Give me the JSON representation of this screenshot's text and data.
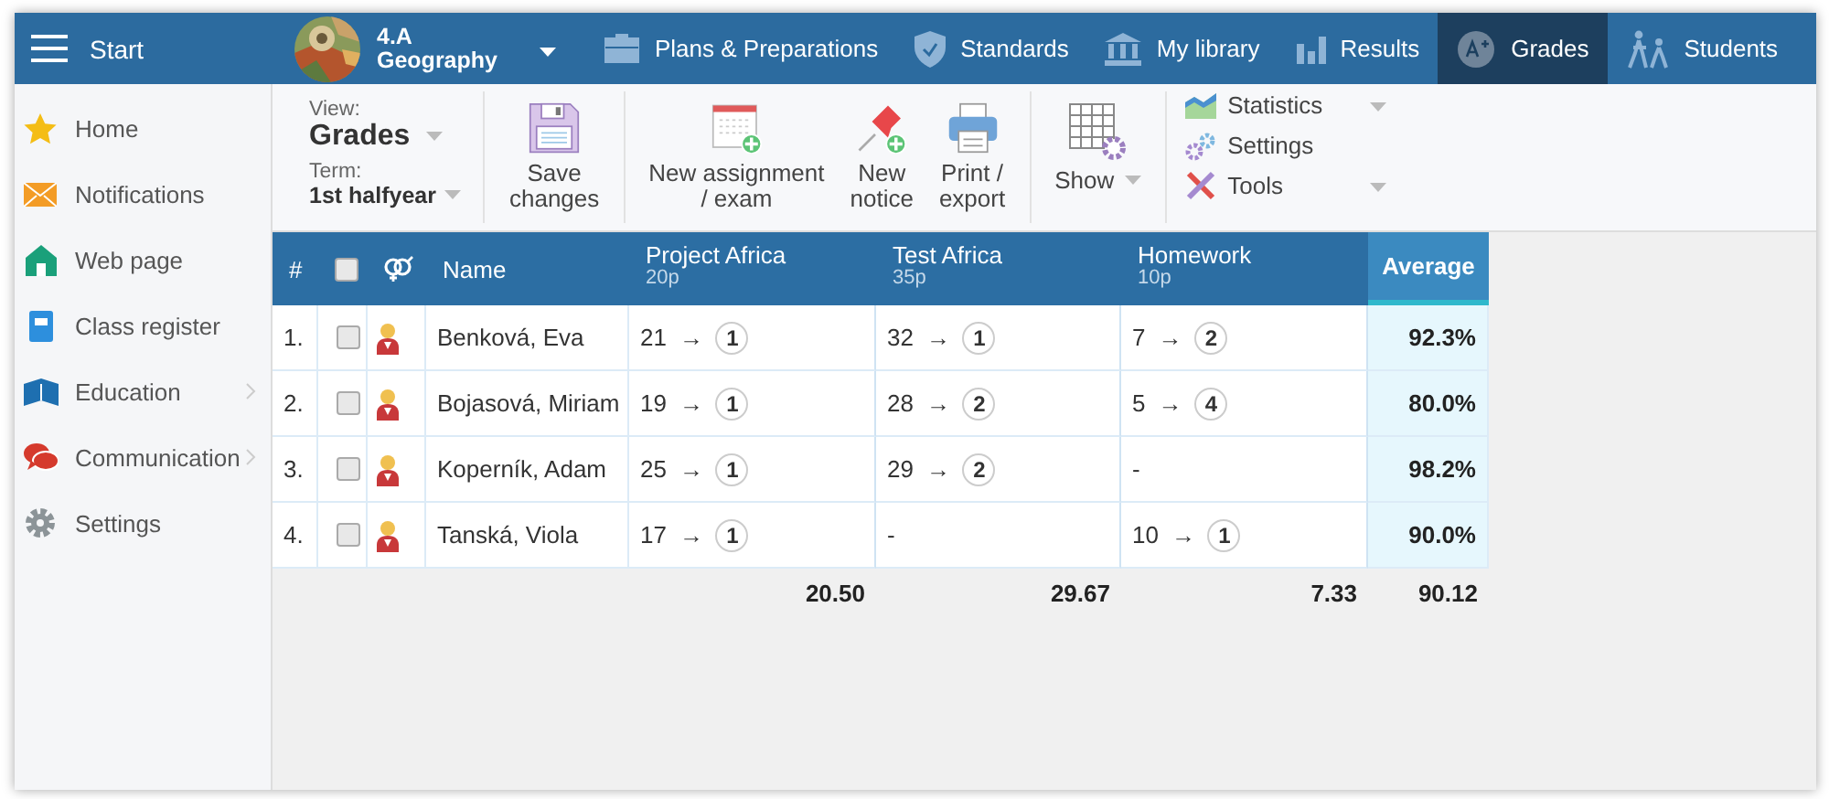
{
  "topbar": {
    "menu_label": "Start",
    "class_name": "4.A",
    "subject": "Geography",
    "nav": [
      {
        "label": "Plans & Preparations",
        "selected": false
      },
      {
        "label": "Standards",
        "selected": false
      },
      {
        "label": "My library",
        "selected": false
      },
      {
        "label": "Results",
        "selected": false
      },
      {
        "label": "Grades",
        "selected": true
      },
      {
        "label": "Students",
        "selected": false
      }
    ]
  },
  "sidebar": {
    "items": [
      {
        "label": "Home",
        "expandable": false
      },
      {
        "label": "Notifications",
        "expandable": false
      },
      {
        "label": "Web page",
        "expandable": false
      },
      {
        "label": "Class register",
        "expandable": false
      },
      {
        "label": "Education",
        "expandable": true
      },
      {
        "label": "Communication",
        "expandable": true
      },
      {
        "label": "Settings",
        "expandable": false
      }
    ]
  },
  "toolbar": {
    "view": {
      "label": "View:",
      "value": "Grades"
    },
    "term": {
      "label": "Term:",
      "value": "1st halfyear"
    },
    "groups": [
      [
        {
          "label": "Save\nchanges",
          "dropdown": false
        }
      ],
      [
        {
          "label": "New assignment\n/ exam",
          "dropdown": false
        },
        {
          "label": "New\nnotice",
          "dropdown": false
        },
        {
          "label": "Print /\nexport",
          "dropdown": false
        }
      ],
      [
        {
          "label": "Show",
          "dropdown": true
        }
      ]
    ],
    "menu": [
      {
        "label": "Statistics",
        "dropdown": true
      },
      {
        "label": "Settings",
        "dropdown": false
      },
      {
        "label": "Tools",
        "dropdown": true
      }
    ]
  },
  "table": {
    "number_header": "#",
    "name_header": "Name",
    "select_all_checked": false,
    "assignments": [
      {
        "title": "Project Africa",
        "points": "20p"
      },
      {
        "title": "Test Africa",
        "points": "35p"
      },
      {
        "title": "Homework",
        "points": "10p"
      }
    ],
    "average_header": "Average",
    "rows": [
      {
        "number": "1.",
        "checked": false,
        "name": "Benková, Eva",
        "scores": [
          {
            "points": "21",
            "arrow": "→",
            "grade": "1"
          },
          {
            "points": "32",
            "arrow": "→",
            "grade": "1"
          },
          {
            "points": "7",
            "arrow": "→",
            "grade": "2"
          }
        ],
        "average": "92.3%"
      },
      {
        "number": "2.",
        "checked": false,
        "name": "Bojasová, Miriam",
        "scores": [
          {
            "points": "19",
            "arrow": "→",
            "grade": "1"
          },
          {
            "points": "28",
            "arrow": "→",
            "grade": "2"
          },
          {
            "points": "5",
            "arrow": "→",
            "grade": "4"
          }
        ],
        "average": "80.0%"
      },
      {
        "number": "3.",
        "checked": false,
        "name": "Koperník, Adam",
        "scores": [
          {
            "points": "25",
            "arrow": "→",
            "grade": "1"
          },
          {
            "points": "29",
            "arrow": "→",
            "grade": "2"
          },
          {
            "empty": "-"
          }
        ],
        "average": "98.2%"
      },
      {
        "number": "4.",
        "checked": false,
        "name": "Tanská, Viola",
        "scores": [
          {
            "points": "17",
            "arrow": "→",
            "grade": "1"
          },
          {
            "empty": "-"
          },
          {
            "points": "10",
            "arrow": "→",
            "grade": "1"
          }
        ],
        "average": "90.0%"
      }
    ],
    "totals": [
      "20.50",
      "29.67",
      "7.33"
    ],
    "total_average": "90.12"
  }
}
